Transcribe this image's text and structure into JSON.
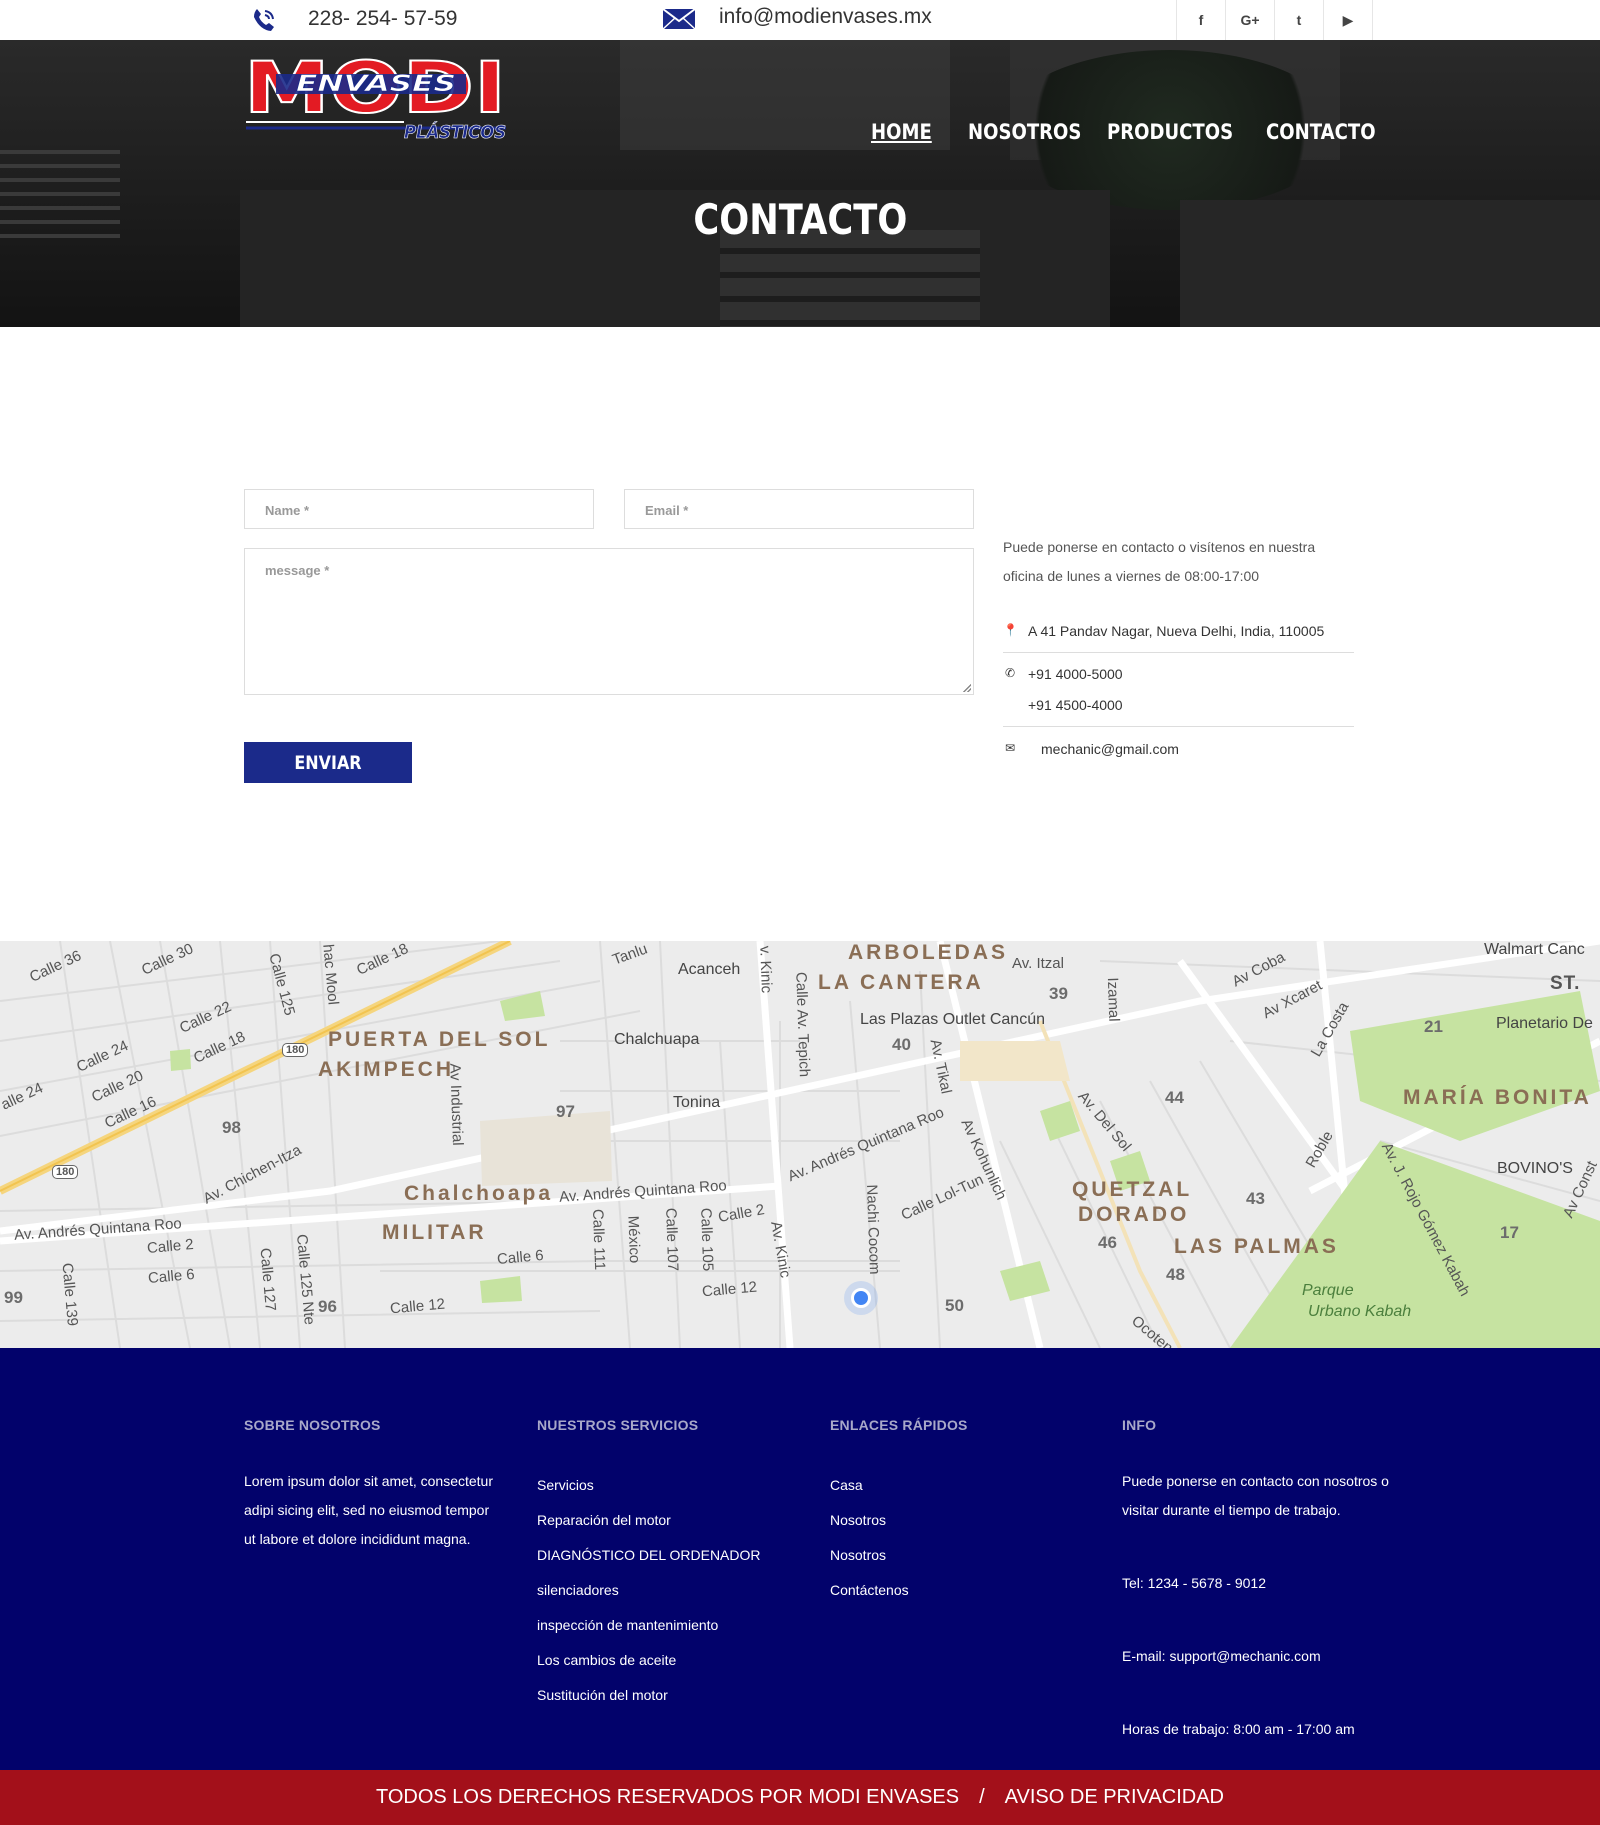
{
  "topbar": {
    "phone": "228- 254- 57-59",
    "email": "info@modienvases.mx",
    "socials": [
      {
        "icon": "facebook-icon",
        "glyph": "f"
      },
      {
        "icon": "google-plus-icon",
        "glyph": "G+"
      },
      {
        "icon": "twitter-icon",
        "glyph": "t"
      },
      {
        "icon": "youtube-icon",
        "glyph": "▶"
      }
    ]
  },
  "brand": {
    "logo_text_main": "MODI",
    "logo_text_banner": "ENVASES",
    "logo_text_sub": "PLÁSTICOS",
    "logo_red": "#e31b23",
    "logo_blue": "#1b2a8a"
  },
  "nav": {
    "items": [
      {
        "label": "HOME",
        "active": true
      },
      {
        "label": "NOSOTROS",
        "active": false
      },
      {
        "label": "PRODUCTOS",
        "active": false
      },
      {
        "label": "CONTACTO",
        "active": false
      }
    ]
  },
  "hero": {
    "title": "CONTACTO"
  },
  "form": {
    "name_placeholder": "Name *",
    "email_placeholder": "Email *",
    "message_placeholder": "message *",
    "submit_label": "ENVIAR",
    "button_color": "#1b2a8a"
  },
  "contact_info": {
    "intro": "Puede ponerse en contacto o visítenos en nuestra oficina de lunes a viernes de 08:00-17:00",
    "address": "A 41 Pandav Nagar, Nueva Delhi, India, 110005",
    "phone_1": "+91 4000-5000",
    "phone_2": "+91 4500-4000",
    "email": "mechanic@gmail.com"
  },
  "map": {
    "labels": {
      "calle36": "Calle 36",
      "calle30": "Calle 30",
      "calle125": "Calle 125",
      "hacmool": "hac Mool",
      "calle18a": "Calle 18",
      "calle22": "Calle 22",
      "calle18b": "Calle 18",
      "calle24a": "Calle 24",
      "calle20": "Calle 20",
      "calle16": "Calle 16",
      "calle24b": "alle 24",
      "puerta": "PUERTA DEL SOL",
      "akimpech": "AKIMPECH",
      "n98": "98",
      "n97": "97",
      "avindustrial": "Av Industrial",
      "chalchuapa": "Chalchuapa",
      "tonina": "Tonina",
      "acanceh": "Acanceh",
      "tanlu": "Tanlu",
      "arboledas": "ARBOLEDAS",
      "cantera": "LA CANTERA",
      "avitzal": "Av. Itzal",
      "n39": "39",
      "plazas": "Las Plazas Outlet Cancún",
      "n40": "40",
      "avtepich": "Calle Av. Tepich",
      "avtikal": "Av. Tikal",
      "izamal": "Izamal",
      "avkinic": "v. Kinic",
      "avcoba": "Av Coba",
      "avxcaret": "Av Xcaret",
      "lacosta": "La Costa",
      "walmart": "Walmart Canc",
      "st": "ST.",
      "planetario": "Planetario De",
      "n21": "21",
      "mariabonita": "MARÍA BONITA",
      "n44": "44",
      "avdelsol": "Av. Del Sol",
      "roble": "Roble",
      "bovinos": "BOVINO'S",
      "n43": "43",
      "quetzal": "QUETZAL",
      "dorado": "DORADO",
      "laspalmas": "LAS PALMAS",
      "n46": "46",
      "n48": "48",
      "n17": "17",
      "parque1": "Parque",
      "parque2": "Urbano Kabah",
      "rojogomez": "Av. J. Rojo Gómez Kabah",
      "chichen": "Av. Chichen-Itza",
      "chalchoapa": "Chalchoapa",
      "aqroo1": "Av. Andrés Quintana Roo",
      "aqroo2": "Av. Andrés Quintana Roo",
      "aqroo3": "Av. Andrés Quintana Roo",
      "militar": "MILITAR",
      "calle2a": "Calle 2",
      "calle6a": "Calle 6",
      "calle127": "Calle 127",
      "calle125nte": "Calle 125 Nte",
      "n96": "96",
      "calle12a": "Calle 12",
      "calle6b": "Calle 6",
      "calle111": "Calle 111",
      "mexico": "México",
      "calle107": "Calle 107",
      "calle105": "Calle 105",
      "calle2b": "Calle 2",
      "calle12b": "Calle 12",
      "nachicocom": "Nachi Cocom",
      "avkinic2": "Av. Kinic",
      "lolttun": "Calle Lol-Tun",
      "kohunlich": "Av Kohunlich",
      "n50": "50",
      "n99": "99",
      "calle139": "Calle 139",
      "avconst": "Av Const",
      "ocoten": "Ocoten",
      "n180a": "180",
      "n180b": "180"
    }
  },
  "footer": {
    "about": {
      "title": "SOBRE NOSOTROS",
      "text": "Lorem ipsum dolor sit amet, consectetur adipi sicing elit, sed no eiusmod tempor ut labore et dolore incididunt magna."
    },
    "services": {
      "title": "NUESTROS SERVICIOS",
      "items": [
        "Servicios",
        "Reparación del motor",
        "DIAGNÓSTICO DEL ORDENADOR",
        "silenciadores",
        "inspección de mantenimiento",
        "Los cambios de aceite",
        "Sustitución del motor"
      ]
    },
    "links": {
      "title": "ENLACES RÁPIDOS",
      "items": [
        "Casa",
        "Nosotros",
        "Nosotros",
        "Contáctenos"
      ]
    },
    "info": {
      "title": "INFO",
      "text": "Puede ponerse en contacto con nosotros o visitar durante el tiempo de trabajo.",
      "tel": "Tel: 1234 - 5678 - 9012",
      "email": "E-mail: support@mechanic.com",
      "hours": "Horas de trabajo: 8:00 am - 17:00 am"
    },
    "bg_color": "#02026b"
  },
  "bottom_bar": {
    "rights": "TODOS LOS DERECHOS RESERVADOS POR MODI ENVASES",
    "separator": "/",
    "privacy": "AVISO DE PRIVACIDAD",
    "bg_color": "#a3101a"
  }
}
